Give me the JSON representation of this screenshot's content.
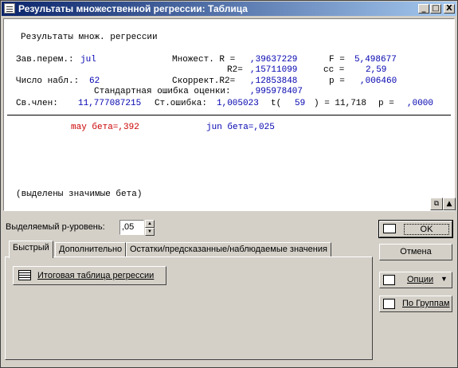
{
  "window": {
    "title": "Результаты множественной регрессии: Таблица",
    "min_btn": "_",
    "max_btn": "□",
    "close_btn": "X"
  },
  "report": {
    "heading": "Результаты множ. регрессии",
    "dep_label": "Зав.перем.:",
    "dep_value": "jul",
    "mult_r_label": "Множест. R =",
    "mult_r_value": ",39637229",
    "f_label": "F =",
    "f_value": "5,498677",
    "r2_label": "R2=",
    "r2_value": ",15711099",
    "cc_label": "сс =",
    "cc_value": "2,59",
    "nobs_label": "Число набл.:",
    "nobs_value": "62",
    "adj_r2_label": "Скоррект.R2=",
    "adj_r2_value": ",12853848",
    "p_label": "p =",
    "p_value": ",006460",
    "se_est_label": "Стандартная ошибка оценки:",
    "se_est_value": ",995978407",
    "intercept_label": "Св.член:",
    "intercept_value": "11,777087215",
    "se_label": "Ст.ошибка:",
    "se_value": "1,005023",
    "t_label": "t(",
    "t_df": "59",
    "t_rest": ") = 11,718",
    "p2_label": "p =",
    "p2_value": ",0000",
    "beta1": "may бета=,392",
    "beta2": "jun бета=,025",
    "footnote": "(выделены значимые бета)"
  },
  "controls": {
    "p_level_label": "Выделяемый р-уровень:",
    "p_level_value": ",05",
    "ok_label": "OK",
    "cancel_label": "Отмена",
    "options_label": "Опции",
    "by_groups_label": "По Группам"
  },
  "tabs": [
    {
      "label": "Быстрый",
      "active": true
    },
    {
      "label": "Дополнительно",
      "active": false
    },
    {
      "label": "Остатки/предсказанные/наблюдаемые значения",
      "active": false
    }
  ],
  "quick_panel": {
    "summary_button": "Итоговая таблица регрессии"
  },
  "colors": {
    "accent_blue": "#0000b0",
    "significant_red": "#cc0000",
    "title_start": "#0a246a",
    "title_end": "#a6caf0"
  }
}
